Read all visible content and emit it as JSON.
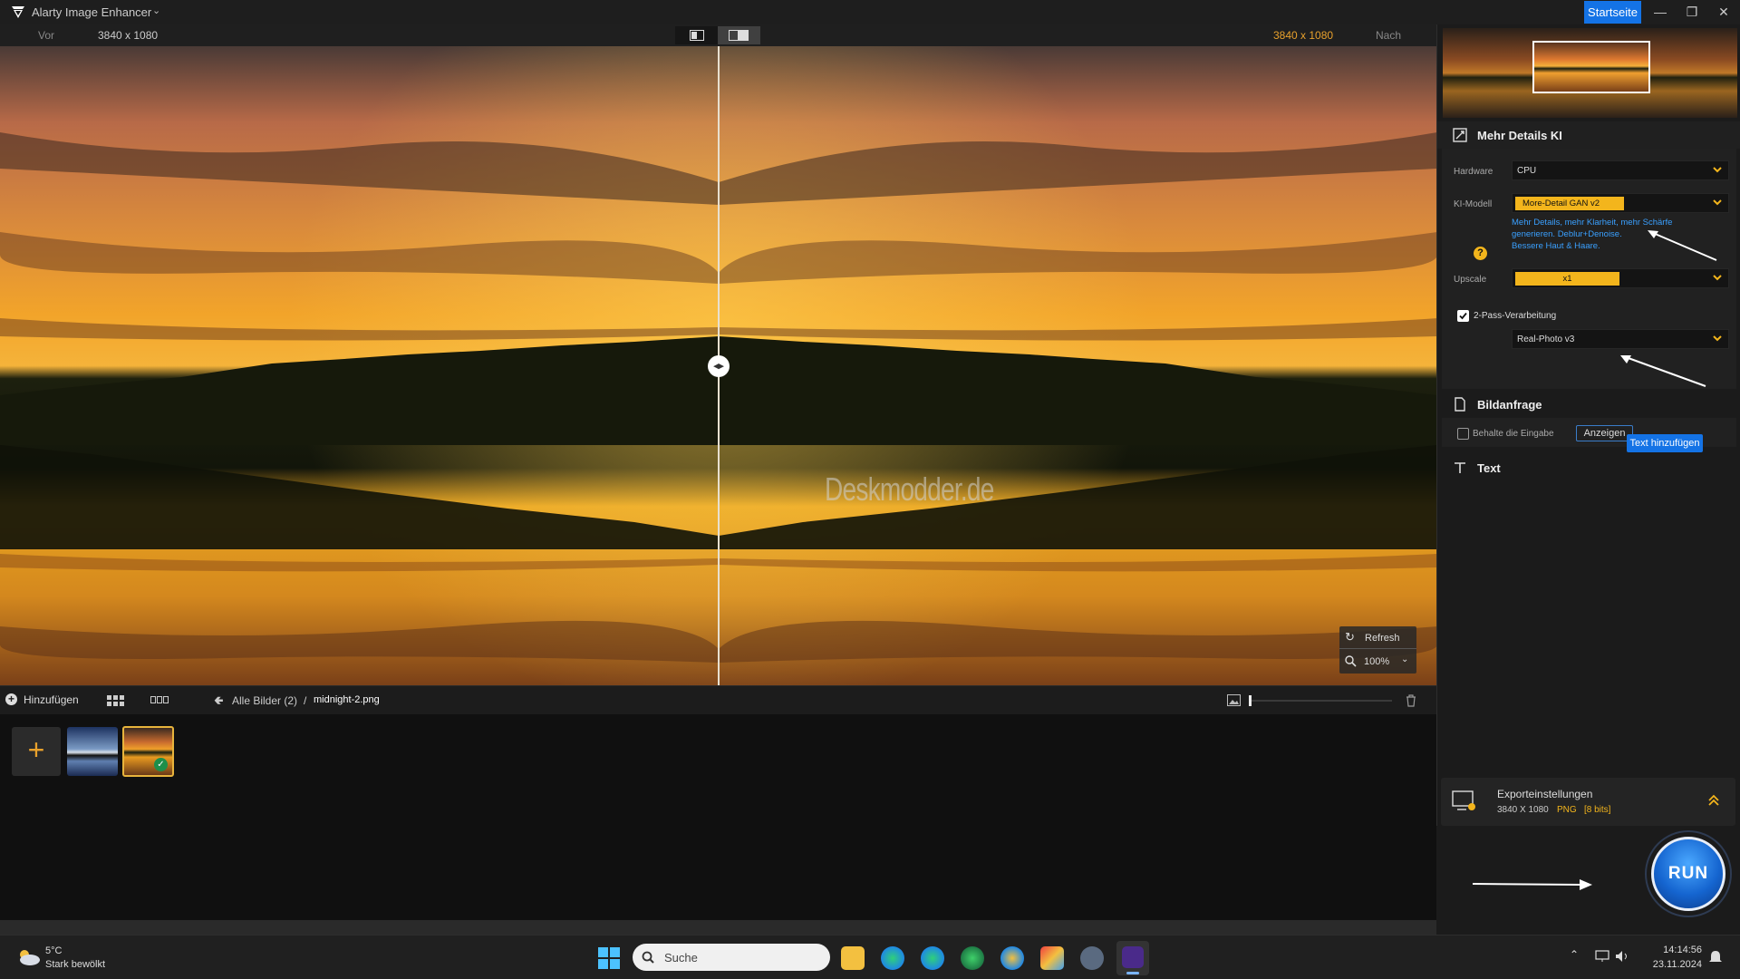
{
  "window": {
    "title": "Alarty Image Enhancer",
    "home_button": "Startseite"
  },
  "infobar": {
    "before_label": "Vor",
    "before_resolution": "3840 x 1080",
    "after_resolution": "3840 x 1080",
    "after_label": "Nach"
  },
  "preview": {
    "watermark": "Deskmodder.de",
    "refresh_label": "Refresh",
    "zoom_value": "100%"
  },
  "bottombar": {
    "add_label": "Hinzufügen",
    "breadcrumb_root": "Alle Bilder (2)",
    "breadcrumb_sep": "/",
    "breadcrumb_file": "midnight-2.png"
  },
  "panel": {
    "section_details": "Mehr Details KI",
    "hardware_label": "Hardware",
    "hardware_value": "CPU",
    "model_label": "KI-Modell",
    "model_value": "More-Detail GAN v2",
    "model_desc_1": "Mehr Details, mehr Klarheit, mehr Schärfe",
    "model_desc_2": "generieren. Deblur+Denoise.",
    "model_desc_3": "Bessere Haut & Haare.",
    "upscale_label": "Upscale",
    "upscale_value": "x1",
    "twopass_label": "2-Pass-Verarbeitung",
    "twopass_model": "Real-Photo v3",
    "section_request": "Bildanfrage",
    "keep_input_label": "Behalte die Eingabe",
    "show_button": "Anzeigen",
    "section_text": "Text",
    "add_text_button": "Text hinzufügen"
  },
  "export": {
    "title": "Exporteinstellungen",
    "resolution": "3840 X 1080",
    "format": "PNG",
    "bits": "[8 bits]",
    "run_label": "RUN"
  },
  "taskbar": {
    "weather_temp": "5°C",
    "weather_desc": "Stark bewölkt",
    "search_placeholder": "Suche",
    "time": "14:14:56",
    "date": "23.11.2024"
  },
  "colors": {
    "accent": "#1473e6",
    "highlight": "#f3b51c",
    "resolution_after": "#e8a12c"
  }
}
